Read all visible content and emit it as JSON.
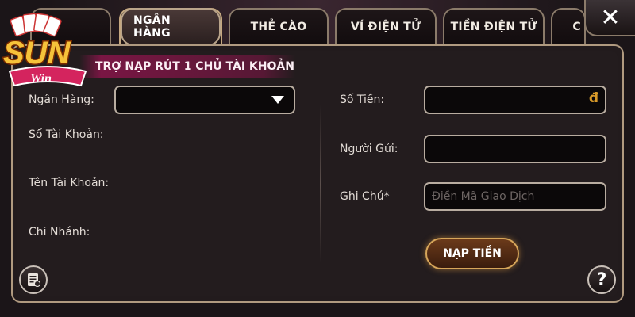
{
  "tabs": [
    {
      "label": "NGÂN HÀNG",
      "active": true
    },
    {
      "label": "THẺ CÀO",
      "active": false
    },
    {
      "label": "VÍ ĐIỆN TỬ",
      "active": false
    },
    {
      "label": "TIỀN ĐIỆN TỬ",
      "active": false
    },
    {
      "label": "C",
      "active": false
    }
  ],
  "logo": {
    "text": "SUN",
    "sub": "Win"
  },
  "banner": {
    "text": "TRỢ NẠP RÚT 1 CHỦ TÀI KHOẢN"
  },
  "left_form": {
    "bank_label": "Ngân Hàng:",
    "account_number_label": "Số Tài Khoản:",
    "account_name_label": "Tên Tài Khoản:",
    "branch_label": "Chi Nhánh:"
  },
  "right_form": {
    "amount_label": "Số Tiền:",
    "amount_currency": "đ",
    "sender_label": "Người Gửi:",
    "note_label": "Ghi Chú*",
    "note_placeholder": "Điền Mã Giao Dịch"
  },
  "deposit_button": {
    "label": "NẠP TIỀN"
  },
  "help_button": {
    "label": "?"
  },
  "close_button": {
    "label": "✕"
  },
  "icons": {
    "history": "history-icon",
    "help": "help-icon",
    "close": "close-icon",
    "dropdown": "chevron-down-icon"
  },
  "colors": {
    "accent_gold": "#d7a65a",
    "currency": "#d89a2a",
    "banner": "#96144f"
  }
}
